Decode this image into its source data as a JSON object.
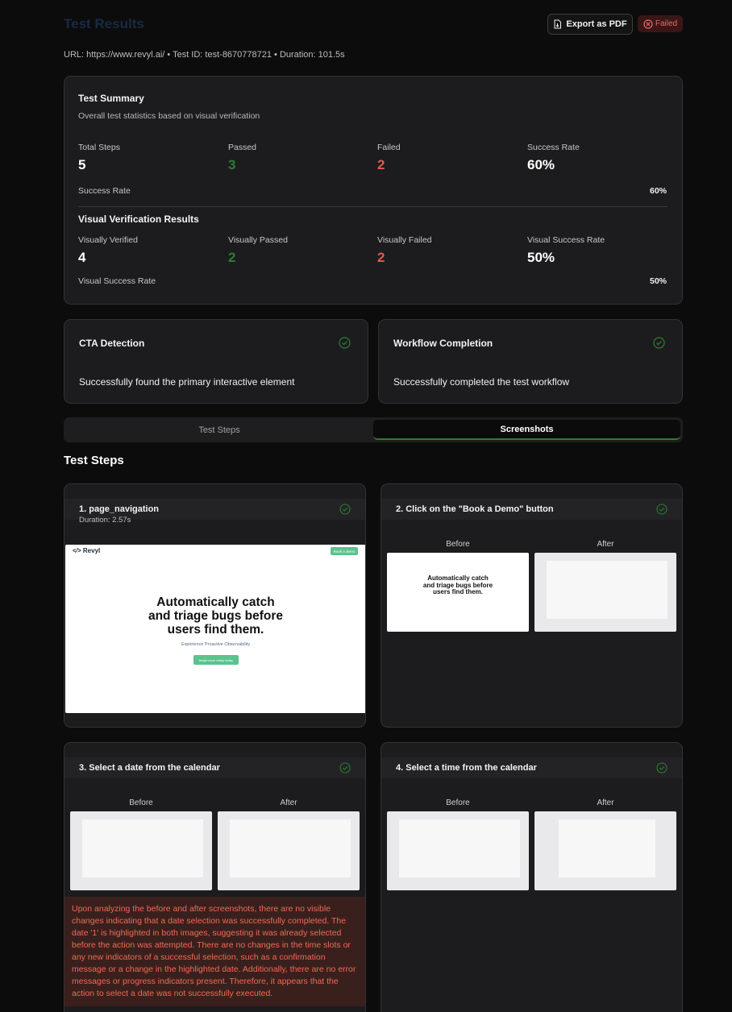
{
  "header": {
    "title": "Test Results",
    "export_label": "Export as PDF",
    "status": "Failed",
    "meta": "URL: https://www.revyl.ai/ • Test ID: test-8670778721 • Duration: 101.5s"
  },
  "summary": {
    "title": "Test Summary",
    "subtitle": "Overall test statistics based on visual verification",
    "stats": [
      {
        "label": "Total Steps",
        "value": "5"
      },
      {
        "label": "Passed",
        "value": "3"
      },
      {
        "label": "Failed",
        "value": "2"
      },
      {
        "label": "Success Rate",
        "value": "60%"
      }
    ],
    "rate_label": "Success Rate",
    "rate_value": "60%",
    "visual_title": "Visual Verification Results",
    "visual_stats": [
      {
        "label": "Visually Verified",
        "value": "4"
      },
      {
        "label": "Visually Passed",
        "value": "2"
      },
      {
        "label": "Visually Failed",
        "value": "2"
      },
      {
        "label": "Visual Success Rate",
        "value": "50%"
      }
    ],
    "visual_rate_label": "Visual Success Rate",
    "visual_rate_value": "50%"
  },
  "checks": [
    {
      "title": "CTA Detection",
      "text": "Successfully found the primary interactive element"
    },
    {
      "title": "Workflow Completion",
      "text": "Successfully completed the test workflow"
    }
  ],
  "tabs": [
    {
      "label": "Test Steps",
      "active": false
    },
    {
      "label": "Screenshots",
      "active": true
    }
  ],
  "steps_title": "Test Steps",
  "steps": [
    {
      "title": "1. page_navigation",
      "duration": "Duration: 2.57s"
    },
    {
      "title": "2. Click on the \"Book a Demo\" button",
      "before": "Before",
      "after": "After"
    },
    {
      "title": "3. Select a date from the calendar",
      "before": "Before",
      "after": "After",
      "analysis": "Upon analyzing the before and after screenshots, there are no visible changes indicating that a date selection was successfully completed. The date '1' is highlighted in both images, suggesting it was already selected before the action was attempted. There are no changes in the time slots or any new indicators of a successful selection, such as a confirmation message or a change in the highlighted date. Additionally, there are no error messages or progress indicators present. Therefore, it appears that the action to select a date was not successfully executed."
    },
    {
      "title": "4. Select a time from the calendar",
      "before": "Before",
      "after": "After"
    }
  ],
  "screenshot_site": {
    "logo": "<⁄> Revyl",
    "cta": "Book a demo",
    "headline": [
      "Automatically catch",
      "and triage bugs before",
      "users find them."
    ],
    "tagline": "Experience Proactive Observability",
    "button": "Begin more today today"
  },
  "colors": {
    "accent_green": "#2e7d32",
    "failed_red": "#e05a4f",
    "brand_green": "#5cc28e"
  }
}
